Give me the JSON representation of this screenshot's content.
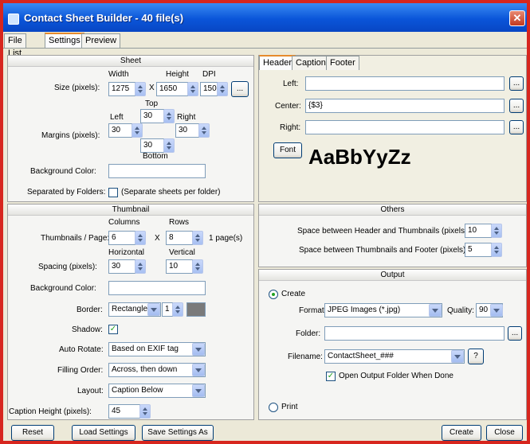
{
  "window": {
    "title": "Contact Sheet Builder - 40 file(s)",
    "close": "✕"
  },
  "tabs": [
    "File List",
    "Settings",
    "Preview"
  ],
  "sheet": {
    "title": "Sheet",
    "width_label": "Width",
    "height_label": "Height",
    "dpi_label": "DPI",
    "size_label": "Size (pixels):",
    "width": "1275",
    "x": "X",
    "height": "1650",
    "dpi": "150",
    "browse": "...",
    "top_label": "Top",
    "left_label": "Left",
    "right_label": "Right",
    "bottom_label": "Bottom",
    "margins_label": "Margins (pixels):",
    "margin_top": "30",
    "margin_left": "30",
    "margin_right": "30",
    "margin_bottom": "30",
    "bg_label": "Background Color:",
    "sep_label": "Separated by Folders:",
    "sep_hint": "(Separate sheets per folder)"
  },
  "hcf": {
    "tabs": [
      "Header",
      "Caption",
      "Footer"
    ],
    "left_label": "Left:",
    "left_value": "",
    "center_label": "Center:",
    "center_value": "{$3}",
    "right_label": "Right:",
    "right_value": "",
    "browse": "...",
    "font_button": "Font",
    "font_sample": "AaBbYyZz"
  },
  "thumbnail": {
    "title": "Thumbnail",
    "columns_label": "Columns",
    "rows_label": "Rows",
    "per_page_label": "Thumbnails / Page:",
    "columns": "6",
    "x": "X",
    "rows": "8",
    "pages": "1 page(s)",
    "horizontal_label": "Horizontal",
    "vertical_label": "Vertical",
    "spacing_label": "Spacing (pixels):",
    "spacing_h": "30",
    "spacing_v": "10",
    "bg_label": "Background Color:",
    "border_label": "Border:",
    "border_value": "Rectangle",
    "border_width": "1",
    "border_color": "#7a7a7a",
    "shadow_label": "Shadow:",
    "rotate_label": "Auto Rotate:",
    "rotate_value": "Based on EXIF tag",
    "order_label": "Filling Order:",
    "order_value": "Across, then down",
    "layout_label": "Layout:",
    "layout_value": "Caption Below",
    "caption_h_label": "Caption Height (pixels):",
    "caption_h": "45"
  },
  "others": {
    "title": "Others",
    "header_space_label": "Space between Header and Thumbnails (pixels):",
    "header_space": "10",
    "footer_space_label": "Space between Thumbnails and Footer (pixels):",
    "footer_space": "5"
  },
  "output": {
    "title": "Output",
    "create_label": "Create",
    "format_label": "Format:",
    "format_value": "JPEG Images (*.jpg)",
    "quality_label": "Quality:",
    "quality_value": "90",
    "folder_label": "Folder:",
    "folder_value": "",
    "browse": "...",
    "filename_label": "Filename:",
    "filename_value": "ContactSheet_###",
    "help": "?",
    "open_folder_label": "Open Output Folder When Done",
    "print_label": "Print"
  },
  "footer": {
    "reset": "Reset",
    "load": "Load Settings",
    "save": "Save Settings As",
    "create": "Create",
    "close": "Close"
  }
}
